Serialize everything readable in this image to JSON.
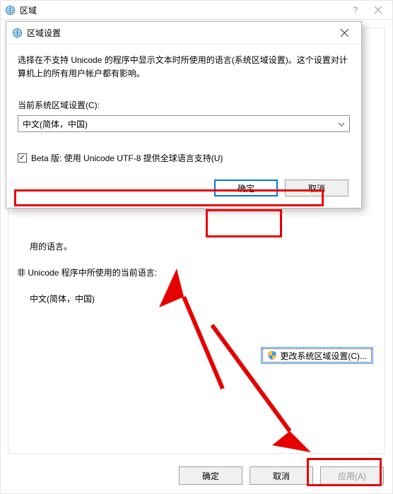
{
  "parent": {
    "title": "区域",
    "remnant_line1": "用的语言。",
    "non_unicode_heading": "非 Unicode 程序中所使用的当前语言:",
    "non_unicode_value": "中文(简体，中国)",
    "change_locale_btn": "更改系统区域设置(C)...",
    "buttons": {
      "ok": "确定",
      "cancel": "取消",
      "apply": "应用(A)"
    }
  },
  "dialog": {
    "title": "区域设置",
    "description": "选择在不支持 Unicode 的程序中显示文本时所使用的语言(系统区域设置)。这个设置对计算机上的所有用户帐户都有影响。",
    "current_locale_label": "当前系统区域设置(C):",
    "current_locale_value": "中文(简体，中国)",
    "beta_checkbox_label": "Beta 版: 使用 Unicode UTF-8 提供全球语言支持(U)",
    "beta_checked_mark": "✓",
    "ok": "确定",
    "cancel": "取消"
  },
  "colors": {
    "annotation": "#e60000",
    "primary": "#0078d7"
  }
}
